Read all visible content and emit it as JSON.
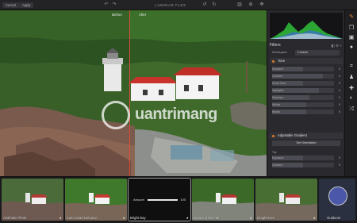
{
  "topbar": {
    "cancel_label": "Cancel",
    "apply_label": "Apply",
    "title": "LUMINAR FLEX"
  },
  "photo": {
    "before_label": "Before",
    "after_label": "After",
    "split_color": "#e04a3a"
  },
  "watermark": {
    "text": "uantrimang"
  },
  "panel": {
    "filters_title": "Filters",
    "workspace_label": "Workspace",
    "workspace_value": "Custom",
    "tone_section": "Tone",
    "tone_sliders": [
      {
        "label": "Exposure",
        "value": "0",
        "level": 0.5
      },
      {
        "label": "Contrast",
        "value": "0",
        "level": 0.82
      },
      {
        "label": "Smart Tone",
        "value": "0",
        "level": 0.5
      },
      {
        "label": "Highlights",
        "value": "0",
        "level": 0.75
      },
      {
        "label": "Shadows",
        "value": "0",
        "level": 0.6
      },
      {
        "label": "Whites",
        "value": "0",
        "level": 0.55
      },
      {
        "label": "Blacks",
        "value": "0",
        "level": 0.55
      }
    ],
    "gradient_section": "Adjustable Gradient",
    "orientation_button": "Set Orientation",
    "top_label": "Top",
    "gradient_sliders": [
      {
        "label": "Exposure",
        "value": "0",
        "level": 0.5
      },
      {
        "label": "Contrast",
        "value": "0",
        "level": 0.5
      }
    ],
    "accent": "#e07b2b"
  },
  "tools": [
    "brush-icon",
    "layers-icon",
    "image-icon",
    "circle-icon",
    "crop-icon",
    "person-icon",
    "bandaid-icon",
    "adjust-icon",
    "arrows-icon"
  ],
  "filmstrip": {
    "thumbs": [
      {
        "caption": "Aesthetic Photo"
      },
      {
        "caption": "Auto Smart Enhance"
      },
      {
        "caption": "Bright Day"
      },
      {
        "caption": "Drama of the Fall"
      },
      {
        "caption": "Dragheroes"
      },
      {
        "caption": "Outdoors"
      }
    ],
    "amount_label": "Amount",
    "amount_value": "100"
  }
}
